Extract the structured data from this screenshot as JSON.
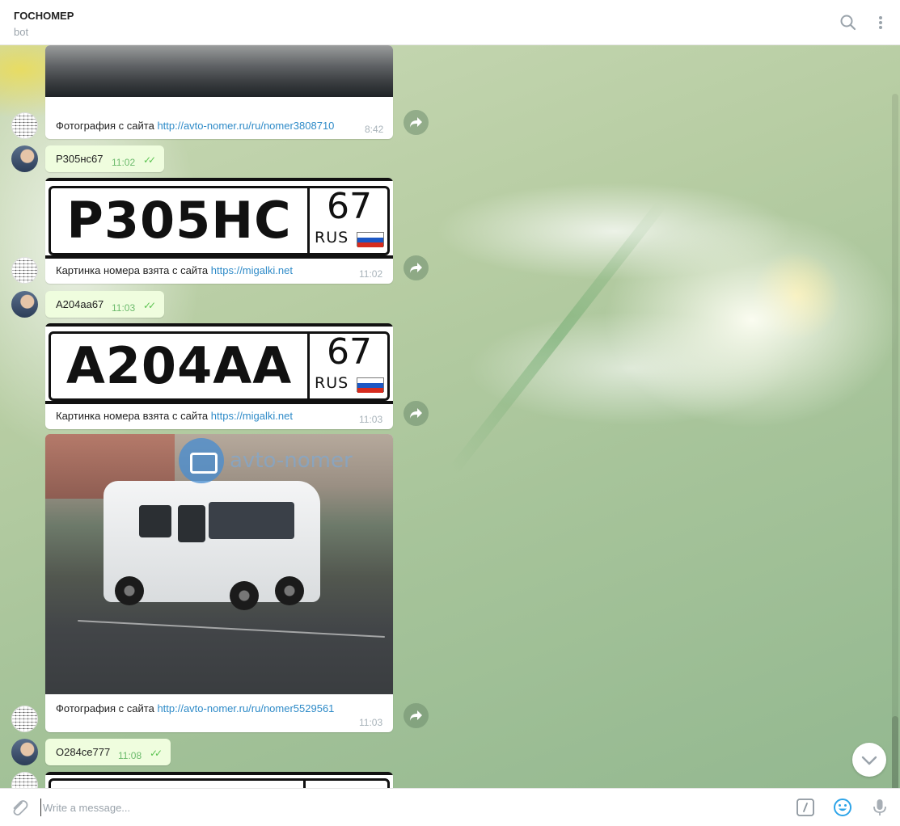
{
  "header": {
    "title": "ГОСНОМЕР",
    "subtitle": "bot",
    "icons": [
      "search-icon",
      "more-vertical-icon"
    ]
  },
  "messages": {
    "m1": {
      "text": "Фотография с сайта ",
      "link": "http://avto-nomer.ru/ru/nomer3808710",
      "time": "8:42"
    },
    "m2": {
      "text": "Р305нс67",
      "time": "11:02"
    },
    "m3": {
      "plate_main": "Р305НС",
      "plate_region": "67",
      "plate_country": "RUS",
      "text": "Картинка номера взята с сайта ",
      "link": "https://migalki.net",
      "time": "11:02"
    },
    "m4": {
      "text": "А204аа67",
      "time": "11:03"
    },
    "m5": {
      "plate_main": "А204АА",
      "plate_region": "67",
      "plate_country": "RUS",
      "text": "Картинка номера взята с сайта ",
      "link": "https://migalki.net",
      "time": "11:03"
    },
    "m6": {
      "watermark": "avto-nomer",
      "text": "Фотография с сайта ",
      "link": "http://avto-nomer.ru/ru/nomer5529561",
      "time": "11:03"
    },
    "m7": {
      "text": "О284се777",
      "time": "11:08"
    }
  },
  "composer": {
    "placeholder": "Write a message...",
    "icons": [
      "attach-icon",
      "bot-command-icon",
      "emoji-icon",
      "microphone-icon"
    ]
  },
  "colors": {
    "link": "#2f8bc8",
    "outgoing_bubble": "#effdde",
    "read_ticks": "#5dc452",
    "accent_blue": "#2da4e8"
  }
}
